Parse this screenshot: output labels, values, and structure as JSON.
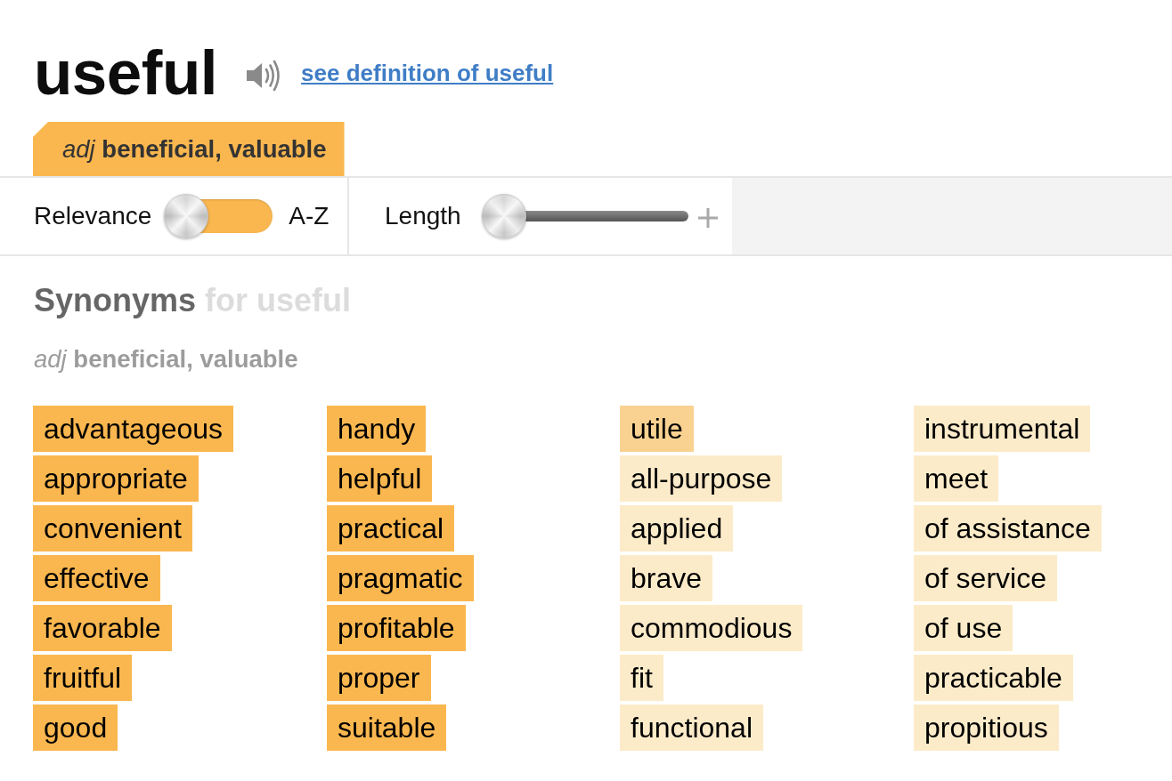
{
  "headword": "useful",
  "definition_link": "see definition of useful",
  "sense_tabs": [
    {
      "label": "*adj* **beneficial, valuable**",
      "selected": true
    }
  ],
  "sort": {
    "left_label": "Relevance",
    "right_label": "A-Z",
    "on": false
  },
  "length": {
    "label": "Length",
    "level": 0
  },
  "synonyms": {
    "title": "Synonyms",
    "qualifier": "for useful",
    "sense": "*adj* **beneficial, valuable**",
    "columns": [
      [
        {
          "word": "advantageous",
          "color": "#fab74f"
        },
        {
          "word": "appropriate",
          "color": "#fab74f"
        },
        {
          "word": "convenient",
          "color": "#fab74f"
        },
        {
          "word": "effective",
          "color": "#fab74f"
        },
        {
          "word": "favorable",
          "color": "#fab74f"
        },
        {
          "word": "fruitful",
          "color": "#fab74f"
        },
        {
          "word": "good",
          "color": "#fab74f"
        }
      ],
      [
        {
          "word": "handy",
          "color": "#fab74f"
        },
        {
          "word": "helpful",
          "color": "#fab74f"
        },
        {
          "word": "practical",
          "color": "#fab74f"
        },
        {
          "word": "pragmatic",
          "color": "#fab74f"
        },
        {
          "word": "profitable",
          "color": "#fab74f"
        },
        {
          "word": "proper",
          "color": "#fab74f"
        },
        {
          "word": "suitable",
          "color": "#fab74f"
        }
      ],
      [
        {
          "word": "utile",
          "color": "#f9d291"
        },
        {
          "word": "all-purpose",
          "color": "#fcebc9"
        },
        {
          "word": "applied",
          "color": "#fcebc9"
        },
        {
          "word": "brave",
          "color": "#fcebc9"
        },
        {
          "word": "commodious",
          "color": "#fcebc9"
        },
        {
          "word": "fit",
          "color": "#fcebc9"
        },
        {
          "word": "functional",
          "color": "#fcebc9"
        }
      ],
      [
        {
          "word": "instrumental",
          "color": "#fcebc9"
        },
        {
          "word": "meet",
          "color": "#fcebc9"
        },
        {
          "word": "of assistance",
          "color": "#fcebc9"
        },
        {
          "word": "of service",
          "color": "#fcebc9"
        },
        {
          "word": "of use",
          "color": "#fcebc9"
        },
        {
          "word": "practicable",
          "color": "#fcebc9"
        },
        {
          "word": "propitious",
          "color": "#fcebc9"
        }
      ]
    ]
  }
}
